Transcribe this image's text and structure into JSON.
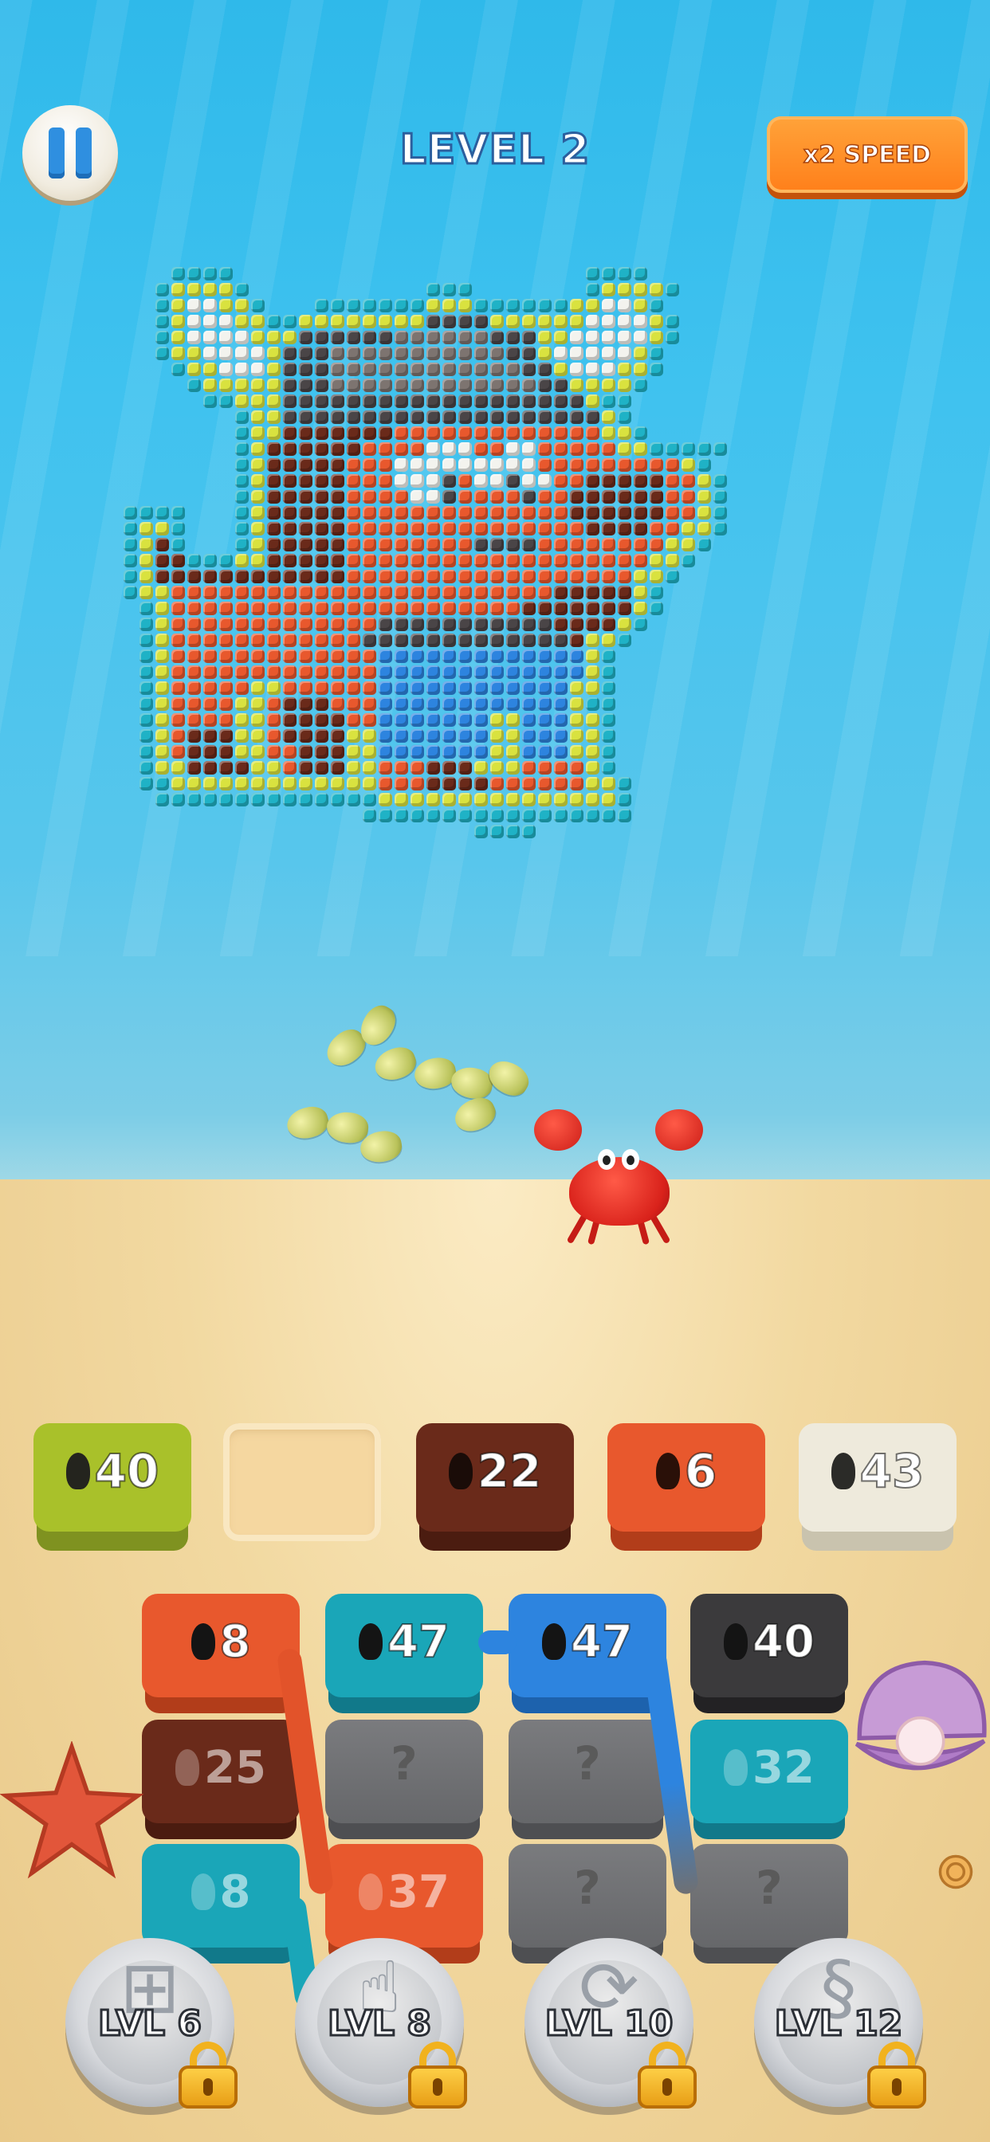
{
  "header": {
    "level_title": "LEVEL 2",
    "speed_label": "x2 SPEED"
  },
  "icons": {
    "pause": "pause-icon",
    "spool": "thread-spool-icon",
    "lock": "padlock-icon"
  },
  "colors": {
    "lime": "#a9c12a",
    "brown": "#6a2a1a",
    "orange": "#e8582d",
    "cream": "#eeeadc",
    "teal": "#1aa6b8",
    "blue": "#2d84df",
    "dark": "#3b3a3c",
    "gray": "#6f7073",
    "yellow": "#d9e23f",
    "cyan": "#1fb2c6",
    "white": "#f3f3ee",
    "darkgray": "#4a4547",
    "stone": "#7d7470",
    "red": "#d54a22",
    "rust": "#b8401f"
  },
  "slots": [
    {
      "count": "40",
      "color": "#a9c12a",
      "base": "#7f9220"
    },
    {
      "count": "",
      "color": "",
      "base": ""
    },
    {
      "count": "22",
      "color": "#6a2a1a",
      "base": "#4b1c10"
    },
    {
      "count": "6",
      "color": "#e8582d",
      "base": "#b23d1a"
    },
    {
      "count": "43",
      "color": "#eeeadc",
      "base": "#c9c3ae"
    }
  ],
  "grid": {
    "columns": [
      [
        {
          "count": "8",
          "color": "#e8582d",
          "base": "#b23d1a",
          "state": "active"
        },
        {
          "count": "25",
          "color": "#6a2a1a",
          "base": "#4b1c10",
          "state": "faded"
        },
        {
          "count": "8",
          "color": "#1aa6b8",
          "base": "#11798a",
          "state": "faded"
        }
      ],
      [
        {
          "count": "47",
          "color": "#1aa6b8",
          "base": "#11798a",
          "state": "active"
        },
        {
          "count": "?",
          "color": "#6f7073",
          "base": "#4e4f52",
          "state": "hidden"
        },
        {
          "count": "37",
          "color": "#e8582d",
          "base": "#b23d1a",
          "state": "faded"
        }
      ],
      [
        {
          "count": "47",
          "color": "#2d84df",
          "base": "#1d62ad",
          "state": "active"
        },
        {
          "count": "?",
          "color": "#6f7073",
          "base": "#4e4f52",
          "state": "hidden"
        },
        {
          "count": "?",
          "color": "#6f7073",
          "base": "#4e4f52",
          "state": "hidden"
        }
      ],
      [
        {
          "count": "40",
          "color": "#3b3a3c",
          "base": "#232224",
          "state": "active"
        },
        {
          "count": "32",
          "color": "#1aa6b8",
          "base": "#11798a",
          "state": "faded"
        },
        {
          "count": "?",
          "color": "#6f7073",
          "base": "#4e4f52",
          "state": "hidden"
        }
      ]
    ]
  },
  "boosters": [
    {
      "label": "LVL 6",
      "icon": "add-slot-icon",
      "glyph": "⊞"
    },
    {
      "label": "LVL 8",
      "icon": "hand-pointer-icon",
      "glyph": "☝"
    },
    {
      "label": "LVL 10",
      "icon": "shuffle-icon",
      "glyph": "⟳"
    },
    {
      "label": "LVL 12",
      "icon": "seahorse-icon",
      "glyph": "§"
    }
  ],
  "pixel_art": {
    "rows": [
      "...cccc......................cccc.....",
      "..cyyyyc...........ccc.......cyyyyc...",
      "..cywwyyc...cccccccyyyccccccyywwyc....",
      "..cywwwyyccyyyyyyyyDDDDyyyyyywwwwyc...",
      "..cywwwwyyyDDDDDDSSSSSSDDDyywwwwwyc...",
      "..cyywwwwyDDDSSSSSSSSSSSDDywwwwwyc....",
      "...cyywwwyDDDSSSSSSSSSSSSDDywwwyyc....",
      "....cyyyyyDDDSSSSSSSSSSSSSDDyyyyc.....",
      ".....ccyyyDDDDDDDDDDDDDDDDDDDycc......",
      ".......cyyDDDDDDDDDDDDDDDDDDDDyc......",
      ".......cyyBBBBBBBOOOOOOOOOOOOOyyc.....",
      ".......cyBBBBBBOOOOwwwOOwwOOOOOyyccccc",
      ".......cyBBBBBOOOwwwwwwwwwOOOOOOOOOyc.",
      ".......cyBBBBBOOOwwwDOwwDwwOOBBBBBOOyc",
      ".......cyBBBBBOOOOwwDOOOODOOBBBBBBOOyc",
      "cccc...cyBBBBBOOOOOOOOOOOOOOBBBBBBOOyc",
      "cyyc...cyBBBBBOOOOOOOOOOOOOOOBBBBOOyyc",
      "cyBc...cyBBBBBOOOOOOOODDDDOOOOOOOOyyc.",
      "cyBBcccyyBBBBBOOOOOOOOOOOOOOOOOOOyyc..",
      "cyBBBBBBBBBBBBOOOOOOOOOOOOOOOOOOyyc...",
      "cyyOOOOOOOOOOOOOOOOOOOOOOOOBBBBByc....",
      ".cyOOOOOOOOOOOOOOOOOOOOOOBBBBBBByc....",
      ".cyOOOOOOOOOOOOODDDDDDDDDDDBBBByc.....",
      ".cyOOOOOOOOOOOODDDDDDDDDDDDDByyc......",
      ".cyOOOOOOOOOOOOOLLLLLLLLLLLLLyc.......",
      ".cyOOOOOOOOOOOOOLLLLLLLLLLLLLyc.......",
      ".cyOOOOOyyOOOOOOLLLLLLLLLLLLyyc.......",
      ".cyOOOOyyOBBBOOOLLLLLLLLLLLLycc.......",
      ".cyOOOOyyOBBBBOOLLLLLLLyyLLLyyc.......",
      ".cyOBBByyOBBBByyLLLLLLLyyLLLyyc.......",
      ".cyOBBByyOOBBByyLLLLLLLyyLLLyyc.......",
      ".cyyBBBByyOBBByyOOOBBByyyOOOOyc.......",
      ".ccyyyyyyyyyyyyyOOOBBBBOOOOOOyyc......",
      "..ccccccccccccccyyyyyyyyyyyyyyyc......",
      "...............ccccccccccccccccc......",
      "......................cccc............"
    ],
    "palette": {
      "c": "#1fb2c6",
      "y": "#d9e23f",
      "w": "#f3f3ee",
      "D": "#4a4547",
      "S": "#7d7470",
      "B": "#6a2a1a",
      "O": "#e8582d",
      "L": "#2d84df"
    }
  }
}
